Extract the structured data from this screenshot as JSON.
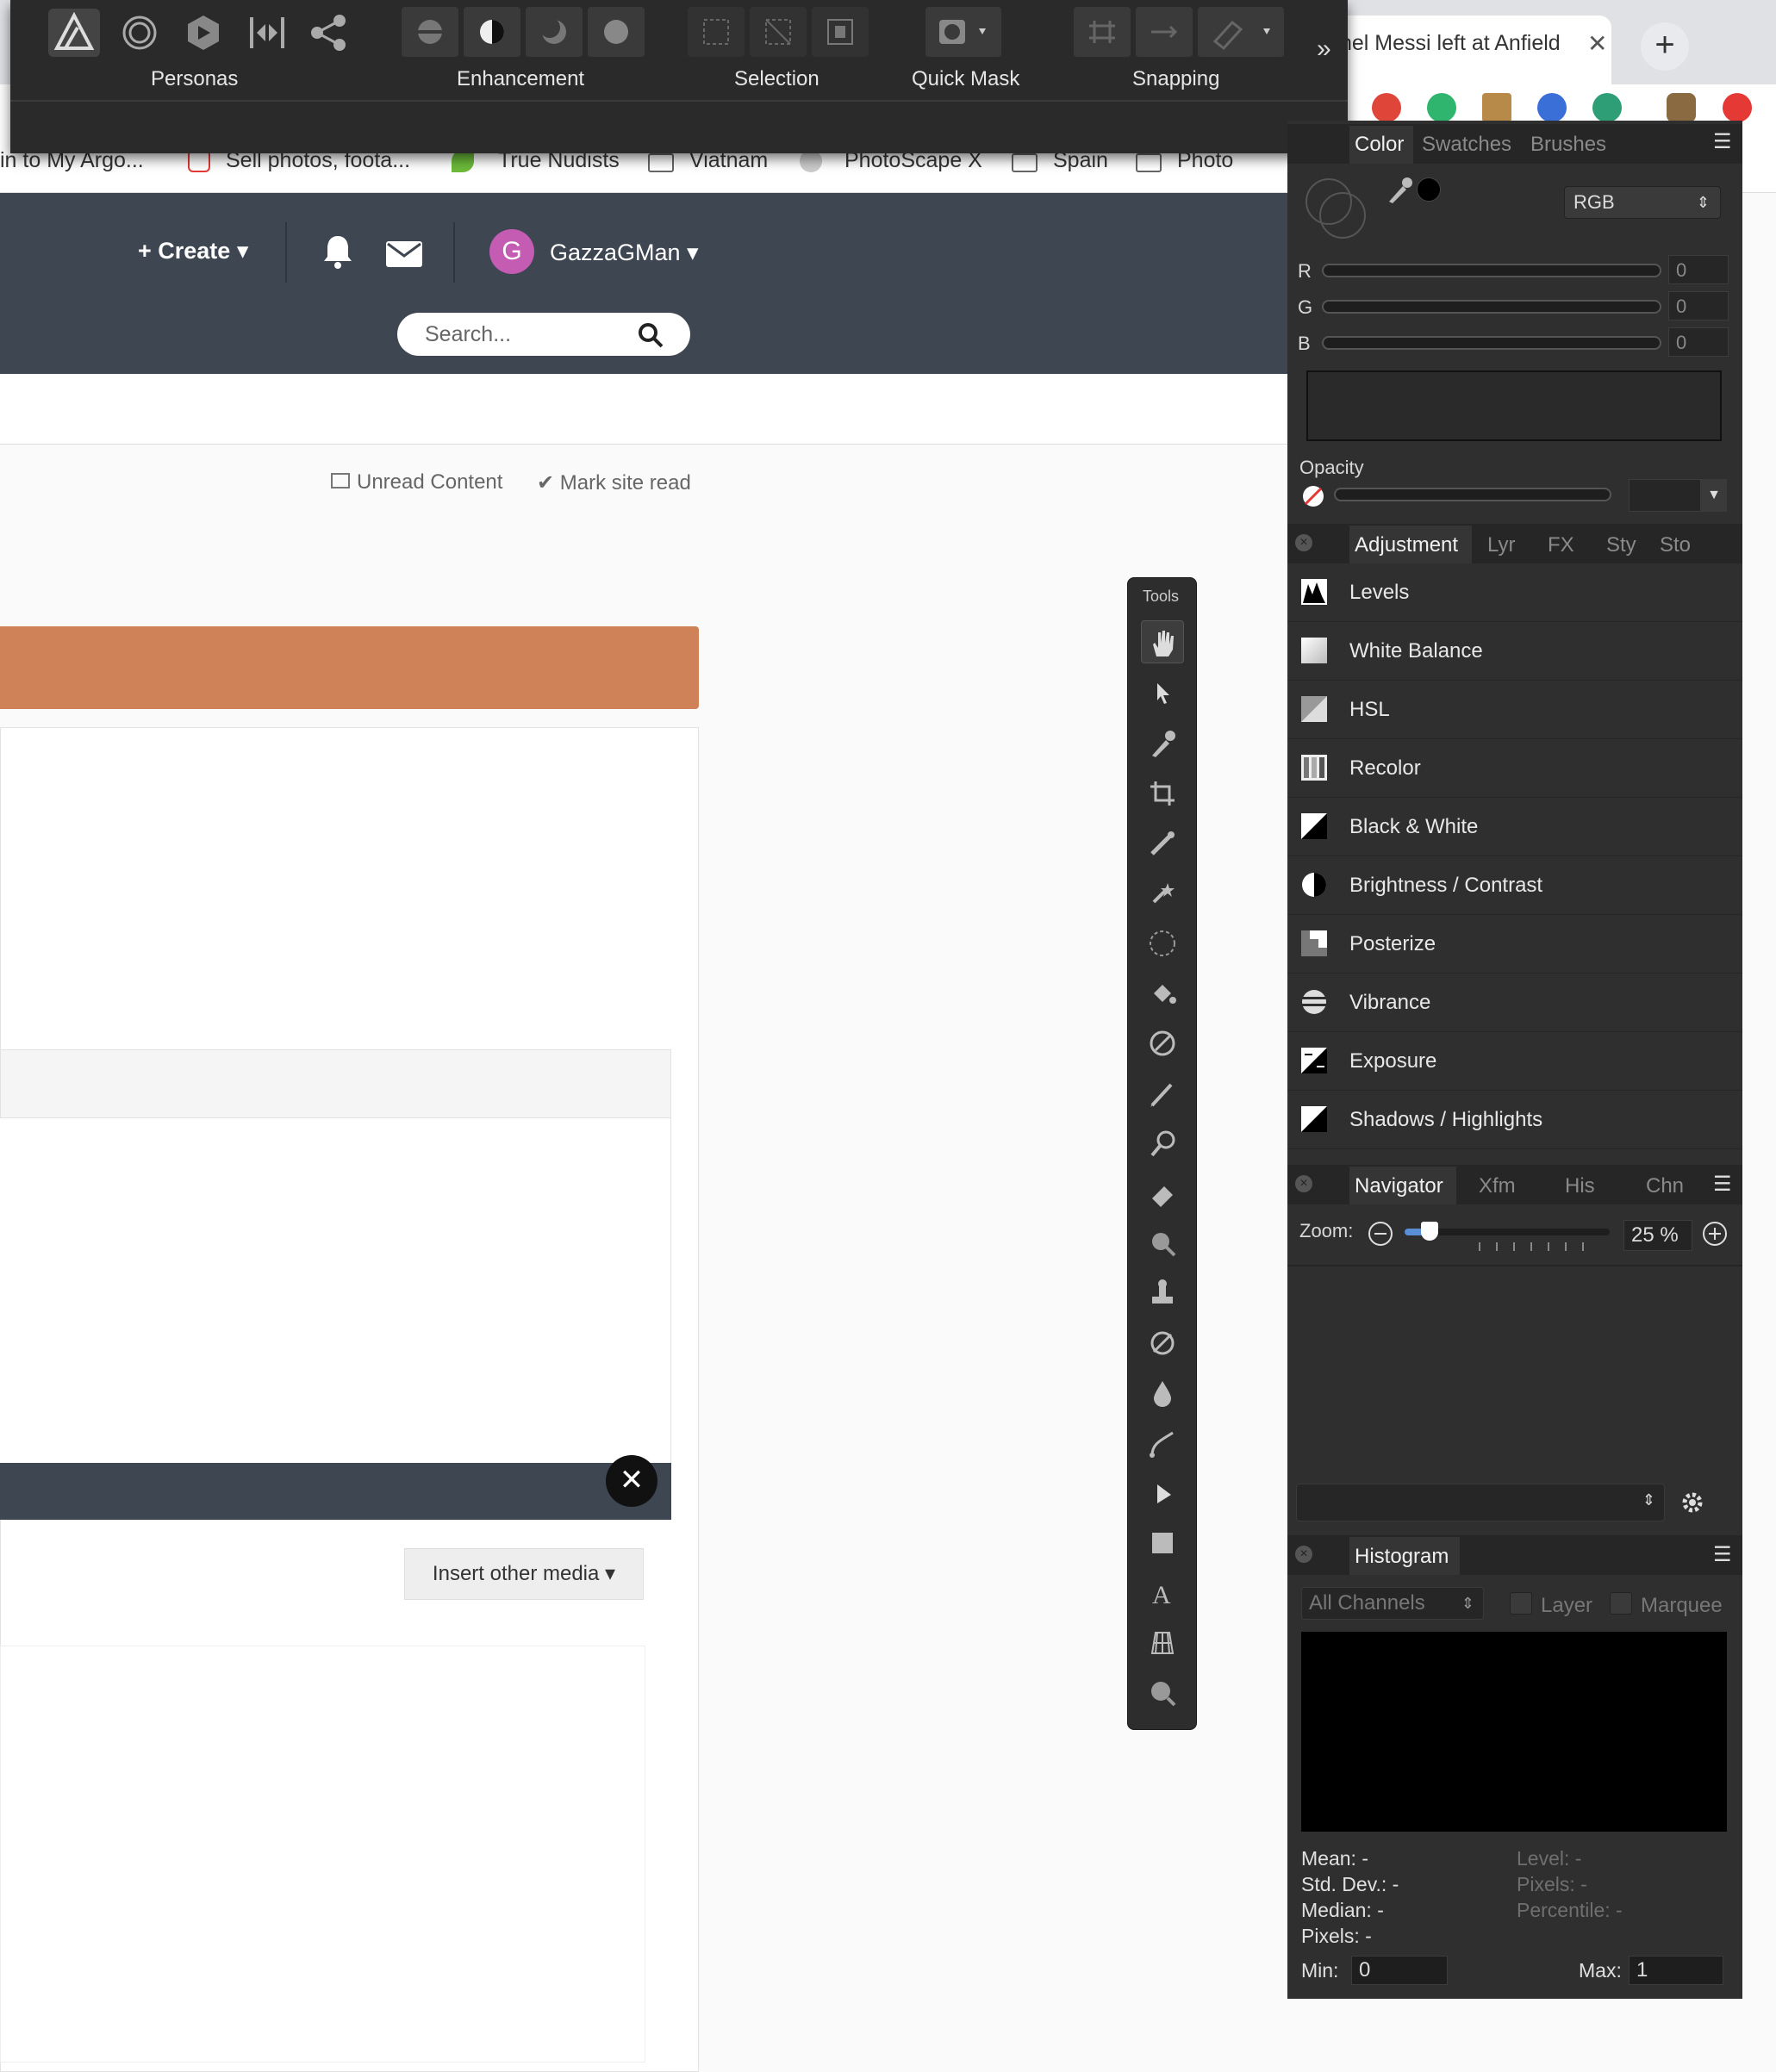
{
  "browser": {
    "tab_title": "nel Messi left at Anfield",
    "tab_close": "✕",
    "new_tab": "+",
    "bookmarks": [
      "in to My Argo...",
      "Sell photos, foota...",
      "True Nudists",
      "Viatnam",
      "PhotoScape X",
      "Spain",
      "Photo"
    ]
  },
  "site": {
    "create_label": "+ Create ▾",
    "avatar_letter": "G",
    "username": "GazzaGMan ▾",
    "search_placeholder": "Search...",
    "unread_content": "Unread Content",
    "mark_site_read": "✔  Mark site read",
    "close_glyph": "✕",
    "insert_media": "Insert other media ▾"
  },
  "affinity_toolbar": {
    "groups": [
      "Personas",
      "Enhancement",
      "Selection",
      "Quick Mask",
      "Snapping"
    ],
    "more": "»"
  },
  "color_panel": {
    "tabs": [
      "Color",
      "Swatches",
      "Brushes"
    ],
    "mode": "RGB",
    "channels": [
      {
        "label": "R",
        "value": "0"
      },
      {
        "label": "G",
        "value": "0"
      },
      {
        "label": "B",
        "value": "0"
      }
    ],
    "opacity_label": "Opacity",
    "accent": "#000000"
  },
  "adjustment_panel": {
    "tabs": [
      "Adjustment",
      "Lyr",
      "FX",
      "Sty",
      "Sto"
    ],
    "items": [
      "Levels",
      "White Balance",
      "HSL",
      "Recolor",
      "Black & White",
      "Brightness / Contrast",
      "Posterize",
      "Vibrance",
      "Exposure",
      "Shadows / Highlights"
    ]
  },
  "navigator_panel": {
    "tabs": [
      "Navigator",
      "Xfm",
      "His",
      "Chn"
    ],
    "zoom_label": "Zoom:",
    "zoom_value": "25 %",
    "zoom_fraction": 0.08
  },
  "histogram_panel": {
    "tab": "Histogram",
    "channel": "All Channels",
    "layer_label": "Layer",
    "marquee_label": "Marquee",
    "stats_left": [
      "Mean: -",
      "Std. Dev.: -",
      "Median: -",
      "Pixels: -"
    ],
    "stats_right": [
      "Level: -",
      "Pixels: -",
      "Percentile: -"
    ],
    "min_label": "Min:",
    "min_value": "0",
    "max_label": "Max:",
    "max_value": "1"
  },
  "tools_panel": {
    "title": "Tools"
  }
}
